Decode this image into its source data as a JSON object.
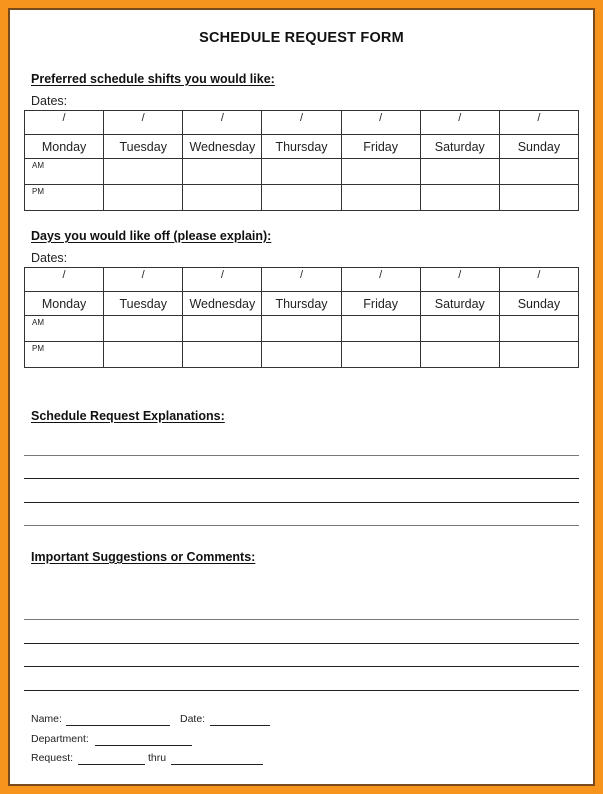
{
  "title": "SCHEDULE REQUEST FORM",
  "border_color": "#F7941D",
  "sections": {
    "preferred": {
      "heading": "Preferred schedule shifts you would like:",
      "dates_label": "Dates:",
      "date_placeholder": "/",
      "days": [
        "Monday",
        "Tuesday",
        "Wednesday",
        "Thursday",
        "Friday",
        "Saturday",
        "Sunday"
      ],
      "shifts": [
        "AM",
        "PM"
      ]
    },
    "days_off": {
      "heading": "Days you would like off (please explain):",
      "dates_label": "Dates:",
      "date_placeholder": "/",
      "days": [
        "Monday",
        "Tuesday",
        "Wednesday",
        "Thursday",
        "Friday",
        "Saturday",
        "Sunday"
      ],
      "shifts": [
        "AM",
        "PM"
      ]
    },
    "explanations": {
      "heading": "Schedule Request Explanations:",
      "line_count": 4
    },
    "comments": {
      "heading": "Important Suggestions or Comments:",
      "line_count": 4
    }
  },
  "footer": {
    "name_label": "Name:",
    "date_label": "Date:",
    "department_label": "Department:",
    "request_label": "Request:",
    "thru_label": "thru"
  }
}
